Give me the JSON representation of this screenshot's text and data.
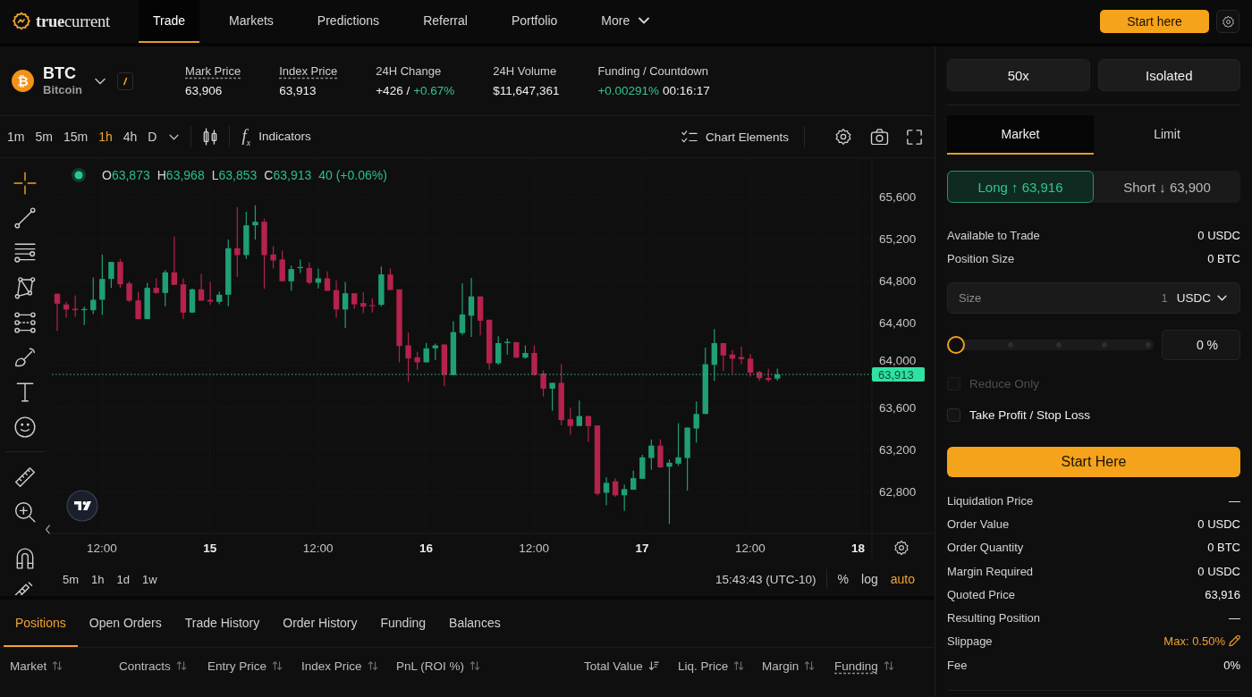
{
  "nav": {
    "logo": "**true**current",
    "items": [
      {
        "label": "Trade",
        "selected": true,
        "kind": "link"
      },
      {
        "label": "Markets",
        "selected": false,
        "kind": "link"
      },
      {
        "label": "Predictions",
        "selected": false,
        "kind": "link"
      },
      {
        "label": "Referral",
        "selected": false,
        "kind": "link"
      },
      {
        "label": "Portfolio",
        "selected": false,
        "kind": "link"
      },
      {
        "label": "More",
        "selected": false,
        "kind": "menu"
      }
    ],
    "cta": "Start here"
  },
  "market": {
    "coin_symbol": "₿",
    "symbol": "BTC",
    "name": "Bitcoin",
    "stats": [
      {
        "label": "Mark Price",
        "underlined": true,
        "values": [
          {
            "text": "63,906",
            "highlight": false
          }
        ]
      },
      {
        "label": "Index Price",
        "underlined": true,
        "values": [
          {
            "text": "63,913",
            "highlight": false
          }
        ]
      },
      {
        "label": "24H Change",
        "underlined": false,
        "values": [
          {
            "text": "+426 /",
            "highlight": false
          },
          {
            "text": "+0.67%",
            "highlight": true
          }
        ]
      },
      {
        "label": "24H Volume",
        "underlined": false,
        "values": [
          {
            "text": "$11,647,361",
            "highlight": false
          }
        ]
      },
      {
        "label": "Funding / Countdown",
        "underlined": false,
        "values": [
          {
            "text": "+0.00291%",
            "highlight": true
          },
          {
            "text": "00:16:17",
            "highlight": false
          }
        ]
      }
    ]
  },
  "chart_toolbar": {
    "intervals": [
      {
        "label": "1m",
        "selected": false
      },
      {
        "label": "5m",
        "selected": false
      },
      {
        "label": "15m",
        "selected": false
      },
      {
        "label": "1h",
        "selected": true
      },
      {
        "label": "4h",
        "selected": false
      },
      {
        "label": "D",
        "selected": false
      }
    ],
    "indicator_symbol": "f$_{x}$",
    "indicators": "Indicators",
    "chart_elements": "Chart Elements"
  },
  "drawing_tools": {
    "groups": [
      [
        {
          "kind": "crosshair",
          "selected": true
        },
        {
          "kind": "trend-line",
          "selected": false
        },
        {
          "kind": "horizontal-lines",
          "selected": false
        },
        {
          "kind": "pattern",
          "selected": false
        },
        {
          "kind": "channel",
          "selected": false
        },
        {
          "kind": "brush",
          "selected": false
        },
        {
          "kind": "text",
          "selected": false
        },
        {
          "kind": "emoji",
          "selected": false
        }
      ],
      [
        {
          "kind": "ruler",
          "selected": false
        },
        {
          "kind": "zoom",
          "selected": false
        }
      ],
      [
        {
          "kind": "magnet",
          "selected": false
        },
        {
          "kind": "lock-pencil",
          "selected": false
        }
      ]
    ]
  },
  "chart": {
    "legend": {
      "items": [
        {
          "key": "O",
          "value": "63,873"
        },
        {
          "key": "H",
          "value": "63,968"
        },
        {
          "key": "L",
          "value": "63,853"
        },
        {
          "key": "C",
          "value": "63,913"
        }
      ],
      "change": "40 (+0.06%)"
    },
    "price_axis": [
      "65,600",
      "65,200",
      "64,800",
      "64,400",
      "64,000",
      "63,600",
      "63,200",
      "62,800"
    ],
    "last_price": "63,913",
    "time_axis": [
      {
        "label": "12:00",
        "major": false
      },
      {
        "label": "15",
        "major": true
      },
      {
        "label": "12:00",
        "major": false
      },
      {
        "label": "16",
        "major": true
      },
      {
        "label": "12:00",
        "major": false
      },
      {
        "label": "17",
        "major": true
      },
      {
        "label": "12:00",
        "major": false
      },
      {
        "label": "18",
        "major": true
      }
    ],
    "ranges": [
      "5m",
      "1h",
      "1d",
      "1w"
    ],
    "clock": "15:43:43 (UTC-10)",
    "scale_options": [
      {
        "label": "%",
        "selected": false
      },
      {
        "label": "log",
        "selected": false
      },
      {
        "label": "auto",
        "selected": true
      }
    ]
  },
  "positions": {
    "tabs": [
      {
        "label": "Positions",
        "selected": true
      },
      {
        "label": "Open Orders",
        "selected": false
      },
      {
        "label": "Trade History",
        "selected": false
      },
      {
        "label": "Order History",
        "selected": false
      },
      {
        "label": "Funding",
        "selected": false
      },
      {
        "label": "Balances",
        "selected": false
      }
    ],
    "columns": [
      {
        "label": "Market",
        "underlined": false,
        "sorted": false
      },
      {
        "label": "Contracts",
        "underlined": false,
        "sorted": false
      },
      {
        "label": "Entry Price",
        "underlined": false,
        "sorted": false
      },
      {
        "label": "Index Price",
        "underlined": false,
        "sorted": false
      },
      {
        "label": "PnL (ROI %)",
        "underlined": false,
        "sorted": false
      },
      {
        "label": "Total Value",
        "underlined": false,
        "sorted": true
      },
      {
        "label": "Liq. Price",
        "underlined": false,
        "sorted": false
      },
      {
        "label": "Margin",
        "underlined": false,
        "sorted": false
      },
      {
        "label": "Funding",
        "underlined": true,
        "sorted": false
      }
    ]
  },
  "order_form": {
    "leverage": "50x",
    "margin_mode": "Isolated",
    "order_types": [
      {
        "label": "Market",
        "selected": true
      },
      {
        "label": "Limit",
        "selected": false
      }
    ],
    "sides": [
      {
        "label": "Long ↑ 63,916",
        "kind": "long",
        "selected": true
      },
      {
        "label": "Short ↓ 63,900",
        "kind": "short",
        "selected": false
      }
    ],
    "balances": [
      {
        "label": "Available to Trade",
        "value": "0 USDC"
      },
      {
        "label": "Position Size",
        "value": "0 BTC"
      }
    ],
    "size": {
      "label": "Size",
      "placeholder": "1",
      "unit": "USDC"
    },
    "slider": {
      "level": 0,
      "percent": "0 %"
    },
    "options": [
      {
        "label": "Reduce Only",
        "checked": false,
        "disabled": true
      },
      {
        "label": "Take Profit / Stop Loss",
        "checked": false,
        "disabled": false
      }
    ],
    "submit": "Start Here",
    "summary": [
      {
        "label": "Liquidation Price",
        "value": "—",
        "editable": false
      },
      {
        "label": "Order Value",
        "value": "0 USDC",
        "editable": false
      },
      {
        "label": "Order Quantity",
        "value": "0 BTC",
        "editable": false
      },
      {
        "label": "Margin Required",
        "value": "0 USDC",
        "editable": false
      },
      {
        "label": "Quoted Price",
        "value": "63,916",
        "editable": false
      },
      {
        "label": "Resulting Position",
        "value": "—",
        "editable": false
      },
      {
        "label": "Slippage",
        "value": "Max: 0.50%",
        "editable": true
      },
      {
        "label": "Fee",
        "value": "0%",
        "editable": false
      }
    ]
  }
}
